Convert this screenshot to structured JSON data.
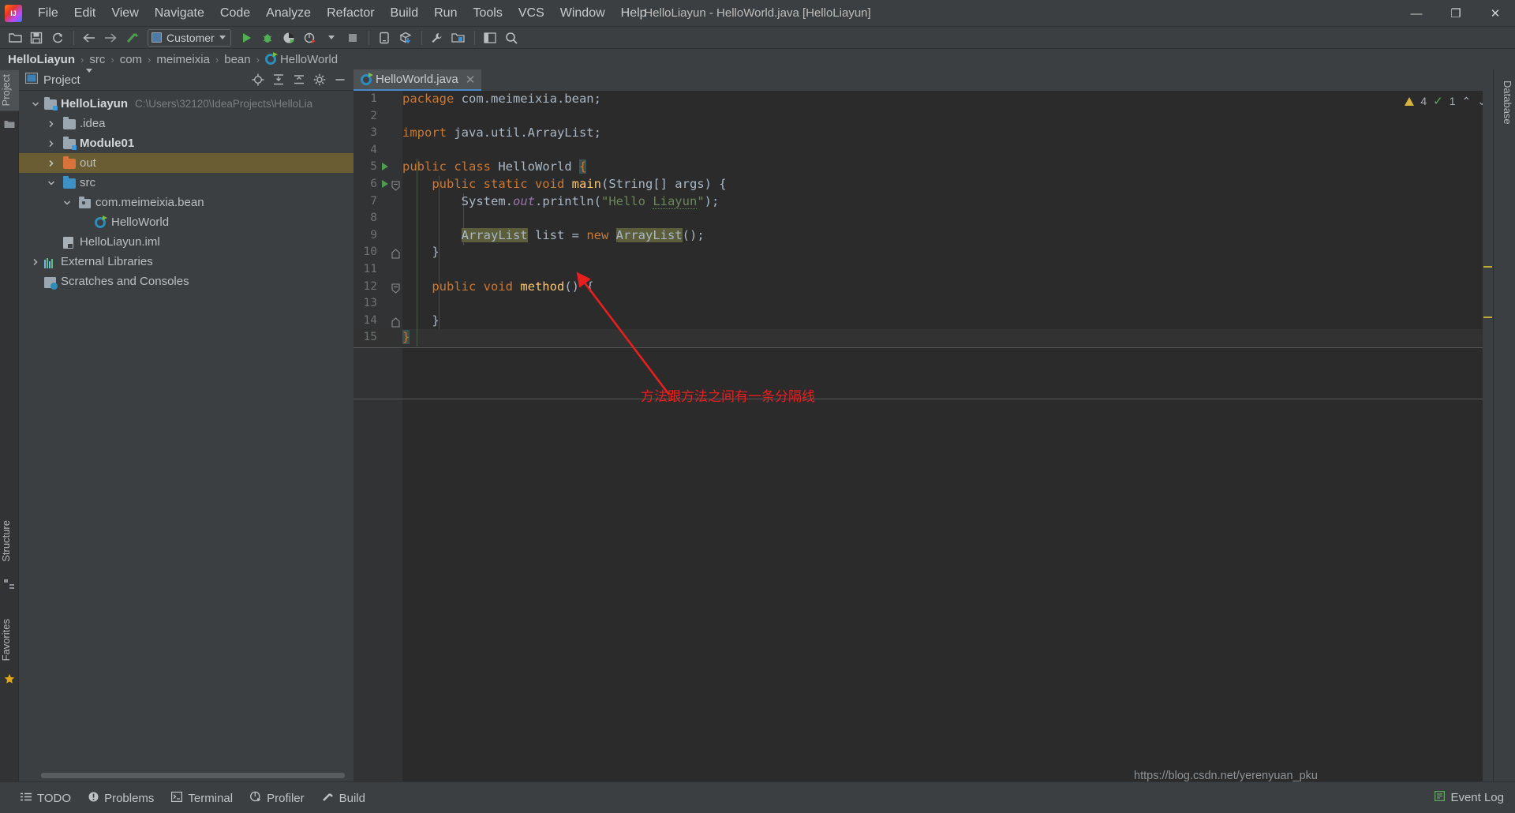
{
  "window": {
    "title": "HelloLiayun - HelloWorld.java [HelloLiayun]",
    "logo_label": "IJ",
    "minimize": "—",
    "maximize": "❐",
    "close": "✕"
  },
  "menubar": {
    "items": [
      {
        "label": "File"
      },
      {
        "label": "Edit"
      },
      {
        "label": "View"
      },
      {
        "label": "Navigate"
      },
      {
        "label": "Code"
      },
      {
        "label": "Analyze"
      },
      {
        "label": "Refactor"
      },
      {
        "label": "Build"
      },
      {
        "label": "Run"
      },
      {
        "label": "Tools"
      },
      {
        "label": "VCS"
      },
      {
        "label": "Window"
      },
      {
        "label": "Help"
      }
    ]
  },
  "toolbar": {
    "open_icon": "open-folder-icon",
    "save_icon": "save-icon",
    "sync_icon": "sync-icon",
    "back_icon": "back-arrow-icon",
    "forward_icon": "forward-arrow-icon",
    "build_icon": "build-hammer-icon",
    "run_config_label": "Customer",
    "run_icon": "run-icon",
    "debug_icon": "debug-icon",
    "coverage_icon": "run-with-coverage-icon",
    "profile_icon": "profile-icon",
    "stop_icon": "stop-icon",
    "device_icon": "device-manager-icon",
    "update_icon": "update-project-icon",
    "settings_icon": "settings-wrench-icon",
    "project_structure_icon": "project-structure-icon",
    "layout_icon": "layout-icon",
    "search_icon": "search-icon"
  },
  "breadcrumb": {
    "items": [
      "HelloLiayun",
      "src",
      "com",
      "meimeixia",
      "bean",
      "HelloWorld"
    ],
    "separator": "›"
  },
  "left_strips": {
    "project_tab": "Project",
    "structure_tab": "Structure",
    "favorites_tab": "Favorites"
  },
  "right_strips": {
    "database_tab": "Database"
  },
  "project_panel": {
    "title": "Project",
    "actions": [
      "locate-icon",
      "expand-all-icon",
      "collapse-all-icon",
      "settings-gear-icon",
      "hide-icon"
    ],
    "tree": [
      {
        "label": "HelloLiayun",
        "path": "C:\\Users\\32120\\IdeaProjects\\HelloLia",
        "depth": 0,
        "arrow": "down",
        "icon": "module-folder",
        "bold": true,
        "highlight": false
      },
      {
        "label": ".idea",
        "path": "",
        "depth": 1,
        "arrow": "right",
        "icon": "folder",
        "bold": false,
        "highlight": false
      },
      {
        "label": "Module01",
        "path": "",
        "depth": 1,
        "arrow": "right",
        "icon": "module-folder",
        "bold": true,
        "highlight": false
      },
      {
        "label": "out",
        "path": "",
        "depth": 1,
        "arrow": "right",
        "icon": "out-folder",
        "bold": false,
        "highlight": true
      },
      {
        "label": "src",
        "path": "",
        "depth": 1,
        "arrow": "down",
        "icon": "source-folder",
        "bold": false,
        "highlight": false
      },
      {
        "label": "com.meimeixia.bean",
        "path": "",
        "depth": 2,
        "arrow": "down",
        "icon": "package",
        "bold": false,
        "highlight": false
      },
      {
        "label": "HelloWorld",
        "path": "",
        "depth": 3,
        "arrow": "none",
        "icon": "java-class",
        "bold": false,
        "highlight": false
      },
      {
        "label": "HelloLiayun.iml",
        "path": "",
        "depth": 1,
        "arrow": "none",
        "icon": "iml-file",
        "bold": false,
        "highlight": false
      },
      {
        "label": "External Libraries",
        "path": "",
        "depth": 0,
        "arrow": "right",
        "icon": "libraries",
        "bold": false,
        "highlight": false
      },
      {
        "label": "Scratches and Consoles",
        "path": "",
        "depth": 0,
        "arrow": "none",
        "icon": "scratches",
        "bold": false,
        "highlight": false
      }
    ]
  },
  "editor": {
    "tab_label": "HelloWorld.java",
    "tab_close": "✕",
    "inspection": {
      "warning_count": "4",
      "check_count": "1",
      "up_arrow": "⌃",
      "down_arrow": "⌄"
    },
    "lines": [
      {
        "n": "1",
        "indent": 0,
        "run": false,
        "fold": "none",
        "tokens": [
          {
            "t": "package ",
            "c": "kw"
          },
          {
            "t": "com.meimeixia.bean;",
            "c": "plain"
          }
        ]
      },
      {
        "n": "2",
        "indent": 0,
        "run": false,
        "fold": "none",
        "tokens": []
      },
      {
        "n": "3",
        "indent": 0,
        "run": false,
        "fold": "none",
        "tokens": [
          {
            "t": "import ",
            "c": "kw"
          },
          {
            "t": "java.util.ArrayList;",
            "c": "plain"
          }
        ]
      },
      {
        "n": "4",
        "indent": 0,
        "run": false,
        "fold": "none",
        "tokens": []
      },
      {
        "n": "5",
        "indent": 0,
        "run": true,
        "fold": "none",
        "tokens": [
          {
            "t": "public class ",
            "c": "kw"
          },
          {
            "t": "HelloWorld ",
            "c": "cls"
          },
          {
            "t": "{",
            "c": "brace-hl"
          }
        ]
      },
      {
        "n": "6",
        "indent": 1,
        "run": true,
        "fold": "open",
        "tokens": [
          {
            "t": "    public static void ",
            "c": "kw"
          },
          {
            "t": "main",
            "c": "fn"
          },
          {
            "t": "(",
            "c": "plain"
          },
          {
            "t": "String",
            "c": "cls"
          },
          {
            "t": "[] args) {",
            "c": "plain"
          }
        ]
      },
      {
        "n": "7",
        "indent": 2,
        "run": false,
        "fold": "none",
        "tokens": [
          {
            "t": "        System.",
            "c": "plain"
          },
          {
            "t": "out",
            "c": "fld"
          },
          {
            "t": ".println(",
            "c": "plain"
          },
          {
            "t": "\"Hello ",
            "c": "str"
          },
          {
            "t": "Liayun",
            "c": "str typo"
          },
          {
            "t": "\"",
            "c": "str"
          },
          {
            "t": ");",
            "c": "plain"
          }
        ]
      },
      {
        "n": "8",
        "indent": 2,
        "run": false,
        "fold": "none",
        "tokens": []
      },
      {
        "n": "9",
        "indent": 2,
        "run": false,
        "fold": "none",
        "tokens": [
          {
            "t": "        ",
            "c": "plain"
          },
          {
            "t": "ArrayList",
            "c": "cls hl"
          },
          {
            "t": " list ",
            "c": "plain"
          },
          {
            "t": "= ",
            "c": "plain"
          },
          {
            "t": "new ",
            "c": "kw"
          },
          {
            "t": "ArrayList",
            "c": "cls hl"
          },
          {
            "t": "();",
            "c": "plain"
          }
        ]
      },
      {
        "n": "10",
        "indent": 1,
        "run": false,
        "fold": "close",
        "tokens": [
          {
            "t": "    }",
            "c": "plain"
          }
        ]
      },
      {
        "n": "11",
        "indent": 1,
        "run": false,
        "fold": "none",
        "tokens": []
      },
      {
        "n": "12",
        "indent": 1,
        "run": false,
        "fold": "open",
        "tokens": [
          {
            "t": "    public void ",
            "c": "kw"
          },
          {
            "t": "method",
            "c": "fn"
          },
          {
            "t": "() {",
            "c": "plain"
          }
        ]
      },
      {
        "n": "13",
        "indent": 2,
        "run": false,
        "fold": "none",
        "tokens": []
      },
      {
        "n": "14",
        "indent": 1,
        "run": false,
        "fold": "close",
        "tokens": [
          {
            "t": "    }",
            "c": "plain"
          }
        ]
      },
      {
        "n": "15",
        "indent": 0,
        "run": false,
        "fold": "none",
        "tokens": [
          {
            "t": "}",
            "c": "brace-hl"
          }
        ]
      }
    ]
  },
  "annotation": {
    "text": "方法跟方法之间有一条分隔线",
    "color": "#e81f1f"
  },
  "statusbar": {
    "items": [
      {
        "label": "TODO",
        "icon": "todo-list-icon"
      },
      {
        "label": "Problems",
        "icon": "problems-icon"
      },
      {
        "label": "Terminal",
        "icon": "terminal-icon"
      },
      {
        "label": "Profiler",
        "icon": "profiler-icon"
      },
      {
        "label": "Build",
        "icon": "build-hammer-icon"
      }
    ],
    "event_log": "Event Log",
    "event_log_icon": "event-log-icon",
    "watermark": "https://blog.csdn.net/yerenyuan_pku"
  },
  "colors": {
    "accent_blue": "#4a88c7",
    "highlight_row": "#6b5d33",
    "editor_bg": "#2b2b2b",
    "panel_bg": "#3c3f41",
    "annotation_red": "#e81f1f"
  }
}
